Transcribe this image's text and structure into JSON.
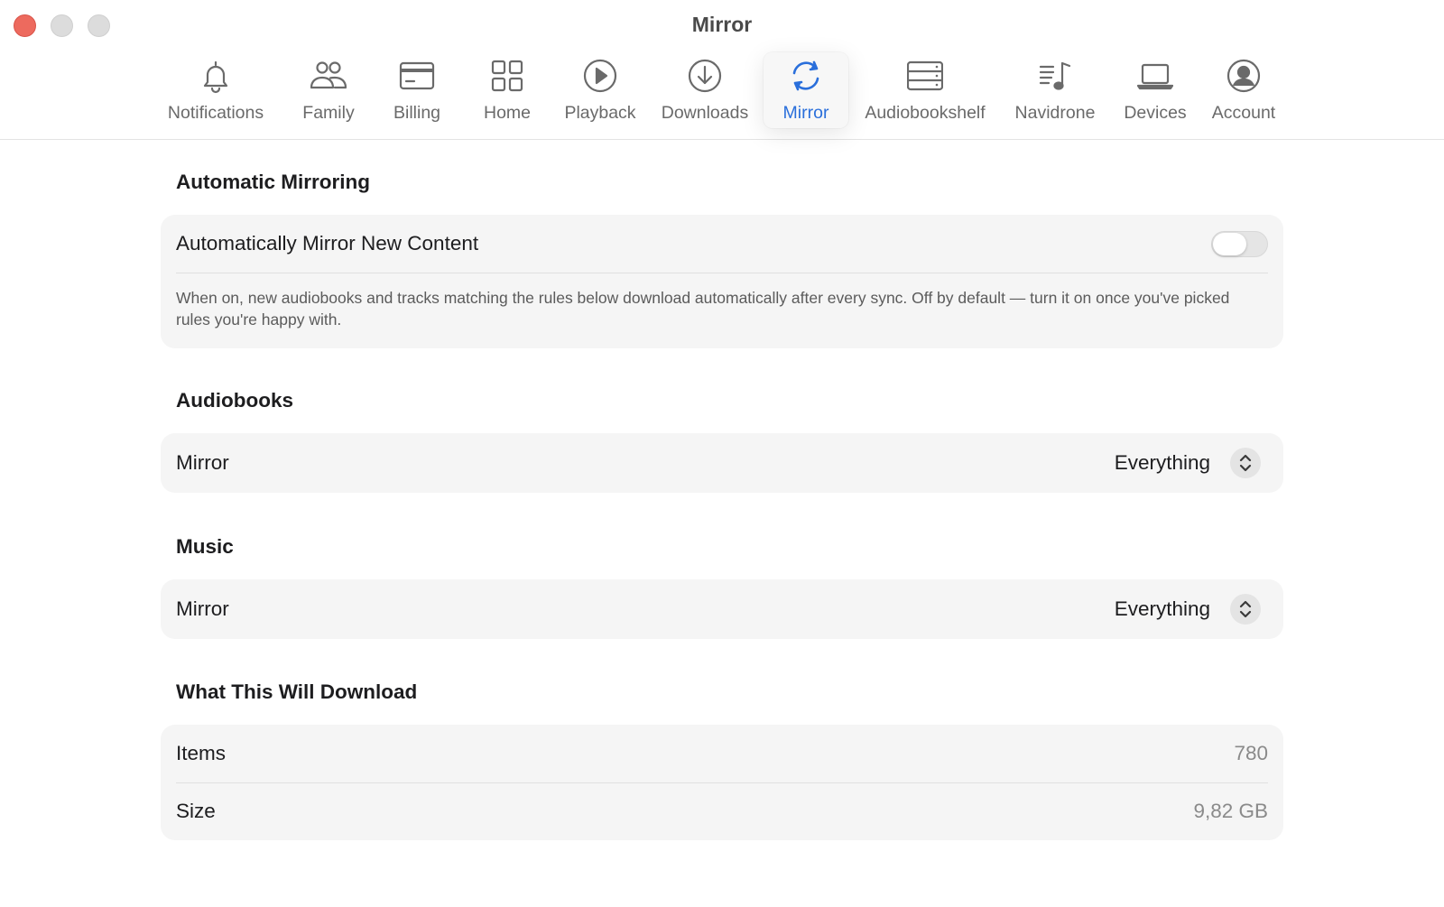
{
  "window": {
    "title": "Mirror"
  },
  "toolbar": {
    "items": [
      {
        "label": "Notifications",
        "icon": "bell-icon"
      },
      {
        "label": "Family",
        "icon": "people-icon"
      },
      {
        "label": "Billing",
        "icon": "creditcard-icon"
      },
      {
        "label": "Home",
        "icon": "grid-icon"
      },
      {
        "label": "Playback",
        "icon": "play-circle-icon"
      },
      {
        "label": "Downloads",
        "icon": "download-circle-icon"
      },
      {
        "label": "Mirror",
        "icon": "sync-arrows-icon",
        "active": true
      },
      {
        "label": "Audiobookshelf",
        "icon": "server-rack-icon"
      },
      {
        "label": "Navidrone",
        "icon": "music-list-icon"
      },
      {
        "label": "Devices",
        "icon": "laptop-icon"
      },
      {
        "label": "Account",
        "icon": "person-circle-icon"
      }
    ],
    "active_color": "#2a6fdb"
  },
  "automatic_mirroring": {
    "title": "Automatic Mirroring",
    "toggle_label": "Automatically Mirror New Content",
    "toggle_on": false,
    "description": "When on, new audiobooks and tracks matching the rules below download automatically after every sync. Off by default — turn it on once you've picked rules you're happy with."
  },
  "audiobooks": {
    "title": "Audiobooks",
    "label": "Mirror",
    "value": "Everything"
  },
  "music": {
    "title": "Music",
    "label": "Mirror",
    "value": "Everything"
  },
  "summary": {
    "title": "What This Will Download",
    "items_label": "Items",
    "items_value": "780",
    "size_label": "Size",
    "size_value": "9,82 GB"
  }
}
